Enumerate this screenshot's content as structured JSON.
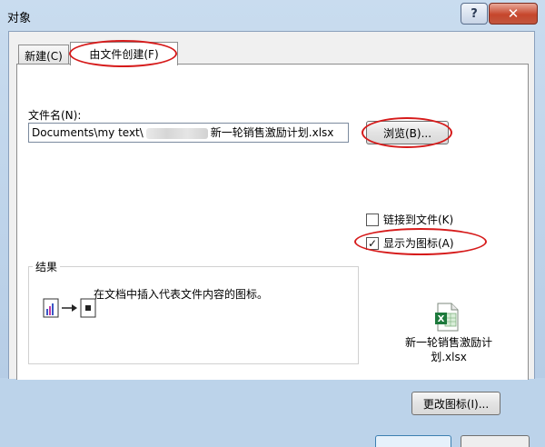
{
  "window": {
    "title": "对象",
    "help_label": "?",
    "close_label": "✕"
  },
  "tabs": [
    {
      "label": "新建(C)"
    },
    {
      "label": "由文件创建(F)"
    }
  ],
  "file": {
    "label": "文件名(N):",
    "value_prefix": "Documents\\my text\\",
    "value_suffix": "新一轮销售激励计划.xlsx"
  },
  "browse_label": "浏览(B)...",
  "options": {
    "link_label": "链接到文件(K)",
    "link_checked": false,
    "display_icon_label": "显示为图标(A)",
    "display_icon_checked": true
  },
  "result": {
    "title": "结果",
    "text": "在文档中插入代表文件内容的图标。"
  },
  "icon_preview": {
    "icon": "excel-file-icon",
    "caption_line1": "新一轮销售激励计",
    "caption_line2": "划.xlsx"
  },
  "change_icon_label": "更改图标(I)...",
  "highlight_color": "#d61b1b"
}
